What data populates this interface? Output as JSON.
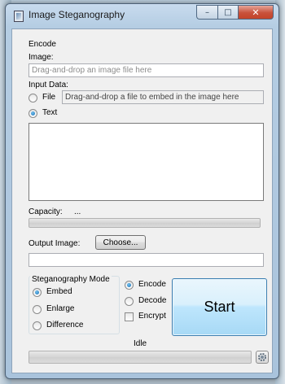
{
  "window": {
    "title": "Image Steganography",
    "close_glyph": "✕",
    "maximize_glyph": "□",
    "minimize_glyph": "–"
  },
  "encode": {
    "group_label": "Encode",
    "image_label": "Image:",
    "image_placeholder": "Drag-and-drop an image file here",
    "input_data_label": "Input Data:",
    "file_label": "File",
    "file_placeholder": "Drag-and-drop a file to embed in the image here",
    "text_label": "Text",
    "text_value": "",
    "selected_input": "Text"
  },
  "capacity": {
    "label": "Capacity:",
    "value": "...",
    "progress": 0
  },
  "output": {
    "label": "Output Image:",
    "choose_button": "Choose...",
    "path_value": ""
  },
  "mode": {
    "group_label": "Steganography Mode",
    "options": [
      "Embed",
      "Enlarge",
      "Difference"
    ],
    "selected": "Embed"
  },
  "operation": {
    "options": [
      "Encode",
      "Decode"
    ],
    "selected": "Encode",
    "encrypt_label": "Encrypt",
    "encrypt_checked": false
  },
  "start_button": "Start",
  "status": {
    "text": "Idle",
    "progress": 0
  },
  "icons": {
    "app": "app-icon",
    "settings": "gear-icon"
  },
  "colors": {
    "start_button_border": "#3c7fb1",
    "radio_dot": "#1c6fb2",
    "close_button": "#c44429"
  }
}
